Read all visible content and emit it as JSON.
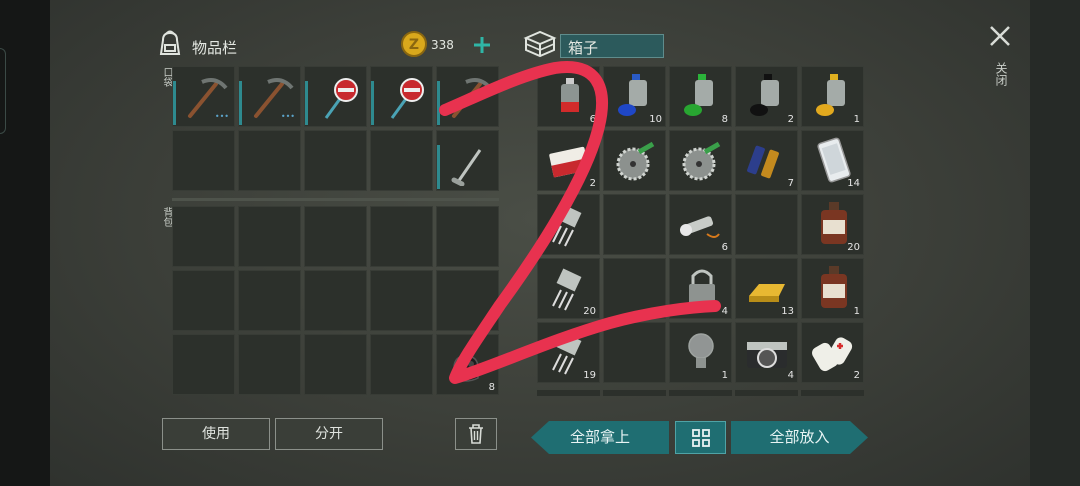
{
  "inventory": {
    "title": "物品栏",
    "coins": "338",
    "pockets_label": "口袋",
    "backpack_label": "背包",
    "pocket_slots": [
      {
        "item": "pickaxe-icon",
        "count": "",
        "durability": true,
        "dots": "•••"
      },
      {
        "item": "pickaxe-icon",
        "count": "",
        "durability": true,
        "dots": "•••"
      },
      {
        "item": "stop-sign-icon",
        "count": "",
        "durability": true,
        "dots": ""
      },
      {
        "item": "stop-sign-icon",
        "count": "",
        "durability": true,
        "dots": ""
      },
      {
        "item": "pickaxe-icon",
        "count": "",
        "durability": true,
        "dots": ""
      },
      {
        "item": "",
        "count": "",
        "durability": false,
        "dots": ""
      },
      {
        "item": "",
        "count": "",
        "durability": false,
        "dots": ""
      },
      {
        "item": "",
        "count": "",
        "durability": false,
        "dots": ""
      },
      {
        "item": "",
        "count": "",
        "durability": false,
        "dots": ""
      },
      {
        "item": "golf-club-icon",
        "count": "",
        "durability": true,
        "dots": ""
      }
    ],
    "backpack_slots": [
      {
        "item": "",
        "count": ""
      },
      {
        "item": "",
        "count": ""
      },
      {
        "item": "",
        "count": ""
      },
      {
        "item": "",
        "count": ""
      },
      {
        "item": "",
        "count": ""
      },
      {
        "item": "",
        "count": ""
      },
      {
        "item": "",
        "count": ""
      },
      {
        "item": "",
        "count": ""
      },
      {
        "item": "",
        "count": ""
      },
      {
        "item": "",
        "count": ""
      },
      {
        "item": "",
        "count": ""
      },
      {
        "item": "",
        "count": ""
      },
      {
        "item": "",
        "count": ""
      },
      {
        "item": "",
        "count": ""
      },
      {
        "item": "gloves-icon",
        "count": "8"
      }
    ],
    "use_button": "使用",
    "split_button": "分开"
  },
  "container": {
    "title": "箱子",
    "slots": [
      {
        "item": "spray-can-red-icon",
        "count": "6"
      },
      {
        "item": "spray-can-blue-icon",
        "count": "10"
      },
      {
        "item": "spray-can-green-icon",
        "count": "8"
      },
      {
        "item": "spray-can-black-icon",
        "count": "2"
      },
      {
        "item": "spray-can-yellow-icon",
        "count": "1"
      },
      {
        "item": "cigarettes-icon",
        "count": "2"
      },
      {
        "item": "saw-blade-icon",
        "count": ""
      },
      {
        "item": "saw-blade-icon",
        "count": ""
      },
      {
        "item": "batteries-icon",
        "count": "7"
      },
      {
        "item": "phone-icon",
        "count": "14"
      },
      {
        "item": "transistor-icon",
        "count": ""
      },
      {
        "item": "",
        "count": ""
      },
      {
        "item": "flashlight-icon",
        "count": "6"
      },
      {
        "item": "",
        "count": ""
      },
      {
        "item": "bottle-icon",
        "count": "20"
      },
      {
        "item": "transistor-icon",
        "count": "20"
      },
      {
        "item": "",
        "count": ""
      },
      {
        "item": "padlock-icon",
        "count": "4"
      },
      {
        "item": "gold-bar-icon",
        "count": "13"
      },
      {
        "item": "bottle-icon",
        "count": "1"
      },
      {
        "item": "transistor-icon",
        "count": "19"
      },
      {
        "item": "",
        "count": ""
      },
      {
        "item": "light-bulb-icon",
        "count": "1"
      },
      {
        "item": "camera-icon",
        "count": "4"
      },
      {
        "item": "bandage-icon",
        "count": "2"
      }
    ],
    "take_all_button": "全部拿上",
    "put_all_button": "全部放入"
  },
  "close_label": "关闭",
  "colors": {
    "accent": "#1f6e72",
    "annotation": "#e8324f",
    "coin": "#d9a81c"
  }
}
